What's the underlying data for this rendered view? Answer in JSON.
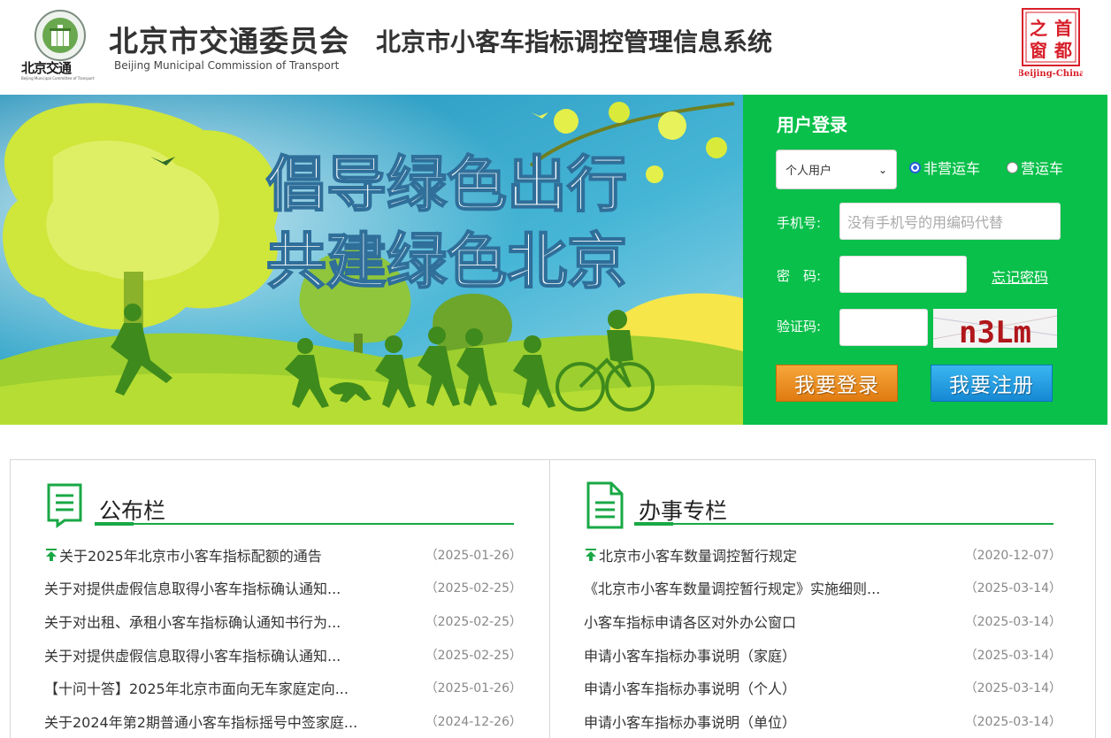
{
  "header": {
    "org_name_cn": "北京市交通委员会",
    "org_name_en": "Beijing Municipal Commission of Transport",
    "logo_small_cn": "北京交通",
    "logo_tiny_en": "Beijing Municipal Committee of Transport",
    "system_title": "北京市小客车指标调控管理信息系统",
    "capital_logo_chars": [
      "首",
      "都",
      "之",
      "窗"
    ],
    "capital_logo_en": "Beijing-China"
  },
  "banner": {
    "line1": "倡导绿色出行",
    "line2": "共建绿色北京"
  },
  "login": {
    "title": "用户登录",
    "user_type_selected": "个人用户",
    "radio_non_operating": "非营运车",
    "radio_operating": "营运车",
    "phone_label": "手机号:",
    "phone_placeholder": "没有手机号的用编码代替",
    "password_label": "密　码:",
    "forgot_password": "忘记密码",
    "captcha_label": "验证码:",
    "captcha_text": "n3Lm",
    "login_button": "我要登录",
    "register_button": "我要注册"
  },
  "bulletin": {
    "title": "公布栏",
    "items": [
      {
        "title": "关于2025年北京市小客车指标配额的通告",
        "date": "（2025-01-26）",
        "pinned": true
      },
      {
        "title": "关于对提供虚假信息取得小客车指标确认通知...",
        "date": "（2025-02-25）",
        "pinned": false
      },
      {
        "title": "关于对出租、承租小客车指标确认通知书行为...",
        "date": "（2025-02-25）",
        "pinned": false
      },
      {
        "title": "关于对提供虚假信息取得小客车指标确认通知...",
        "date": "（2025-02-25）",
        "pinned": false
      },
      {
        "title": "【十问十答】2025年北京市面向无车家庭定向...",
        "date": "（2025-01-26）",
        "pinned": false
      },
      {
        "title": "关于2024年第2期普通小客车指标摇号中签家庭...",
        "date": "（2024-12-26）",
        "pinned": false
      }
    ]
  },
  "services": {
    "title": "办事专栏",
    "items": [
      {
        "title": "北京市小客车数量调控暂行规定",
        "date": "（2020-12-07）",
        "pinned": true
      },
      {
        "title": "《北京市小客车数量调控暂行规定》实施细则...",
        "date": "（2025-03-14）",
        "pinned": false
      },
      {
        "title": "小客车指标申请各区对外办公窗口",
        "date": "（2025-03-14）",
        "pinned": false
      },
      {
        "title": "申请小客车指标办事说明（家庭）",
        "date": "（2025-03-14）",
        "pinned": false
      },
      {
        "title": "申请小客车指标办事说明（个人）",
        "date": "（2025-03-14）",
        "pinned": false
      },
      {
        "title": "申请小客车指标办事说明（单位）",
        "date": "（2025-03-14）",
        "pinned": false
      }
    ]
  },
  "colors": {
    "login_bg": "#08c04a",
    "accent_green": "#19a845",
    "login_btn": "#e58a1c",
    "register_btn": "#1f98df",
    "capital_red": "#d8202a"
  }
}
